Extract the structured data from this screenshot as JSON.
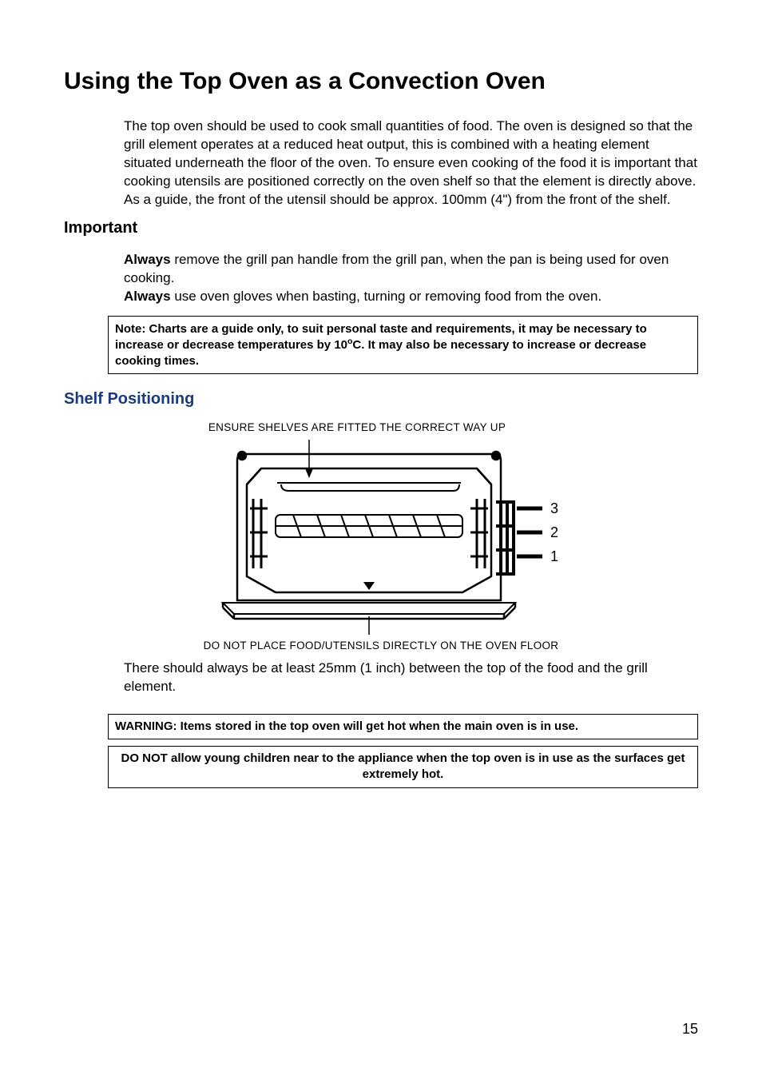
{
  "title": "Using the Top Oven as a Convection Oven",
  "intro": "The top oven should be used to cook small quantities of food. The oven is designed so that the grill element operates at a reduced heat output, this is combined with a heating element situated underneath the floor of the oven. To ensure even cooking of the food it is important that cooking utensils are positioned correctly on the oven shelf so that the element is directly above. As a guide, the front of the utensil should be approx. 100mm (4\") from the front of the shelf.",
  "importantHeading": "Important",
  "important1_bold": "Always",
  "important1_rest": " remove the grill pan handle from the grill pan, when the pan is being used for oven cooking.",
  "important2_bold": "Always",
  "important2_rest": " use oven gloves when basting, turning or removing food from the oven.",
  "note_pre": "Note: Charts are a guide only, to suit personal taste and requirements, it may be necessary to increase or decrease temperatures by 10",
  "note_degree": "o",
  "note_post": "C. It may also be necessary to increase or decrease cooking times.",
  "shelfHeading": "Shelf Positioning",
  "diagramTop": "ENSURE SHELVES ARE FITTED THE CORRECT WAY UP",
  "diagramBottom": "DO NOT PLACE FOOD/UTENSILS DIRECTLY ON THE OVEN FLOOR",
  "shelfLabels": {
    "1": "1",
    "2": "2",
    "3": "3"
  },
  "afterDiagram": "There should always be at least 25mm (1 inch) between the top of the food and the grill element.",
  "warning1": "WARNING: Items stored in the top oven will get hot when the main oven is in use.",
  "warning2": "DO NOT allow young children near to the appliance when the top oven is in use as the surfaces get extremely hot.",
  "pageNumber": "15"
}
